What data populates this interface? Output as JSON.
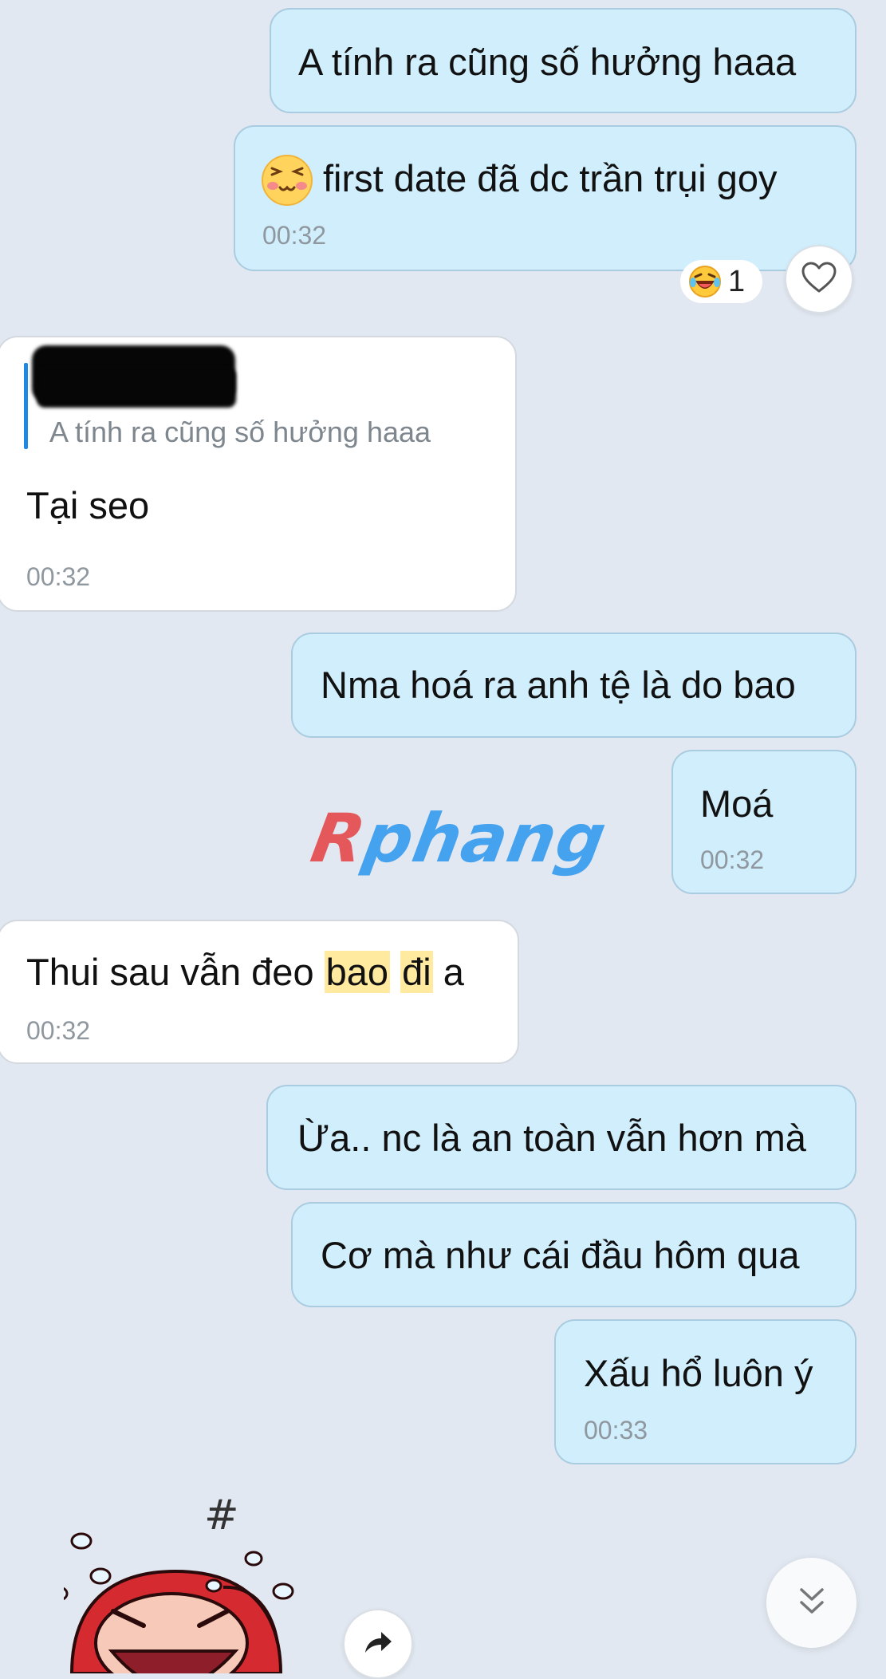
{
  "conversation": {
    "messages": [
      {
        "id": "m1",
        "direction": "sent",
        "text": "A tính ra cũng số hưởng haaa"
      },
      {
        "id": "m2",
        "direction": "sent",
        "text": "first date đã dc trần trụi goy",
        "time": "00:32"
      },
      {
        "id": "m3",
        "direction": "received",
        "quote_text": "A tính ra cũng số hưởng haaa",
        "text": "Tại seo",
        "time": "00:32"
      },
      {
        "id": "m4",
        "direction": "sent",
        "text": "Nma hoá ra anh tệ là do bao"
      },
      {
        "id": "m5",
        "direction": "sent",
        "text": "Moá",
        "time": "00:32"
      },
      {
        "id": "m6",
        "direction": "received",
        "text_parts": [
          "Thui sau vẫn đeo ",
          "bao",
          " ",
          "đi",
          " a"
        ],
        "highlighted_words": [
          "bao",
          "đi"
        ],
        "time": "00:32"
      },
      {
        "id": "m7",
        "direction": "sent",
        "text": "Ừa.. nc là an toàn vẫn hơn mà"
      },
      {
        "id": "m8",
        "direction": "sent",
        "text": "Cơ mà như cái đầu hôm qua"
      },
      {
        "id": "m9",
        "direction": "sent",
        "text": "Xấu hổ luôn ý",
        "time": "00:33"
      }
    ]
  },
  "reaction": {
    "emoji": "laughing-face-icon",
    "count": "1"
  },
  "watermark": {
    "text_first": "R",
    "text_rest": "phang"
  },
  "sticker": {
    "symbol": "#"
  },
  "icons": {
    "heart": "heart-icon",
    "scroll_down": "double-chevron-down-icon",
    "share": "share-arrow-icon"
  },
  "colors": {
    "background": "#E2E8F1",
    "sent_bubble": "#D1EEFC",
    "received_bubble": "#FFFFFF",
    "highlight": "#FFEAA0",
    "quote_bar": "#1E88E5",
    "watermark_red": "#E4585B",
    "watermark_blue": "#45A2EE"
  }
}
